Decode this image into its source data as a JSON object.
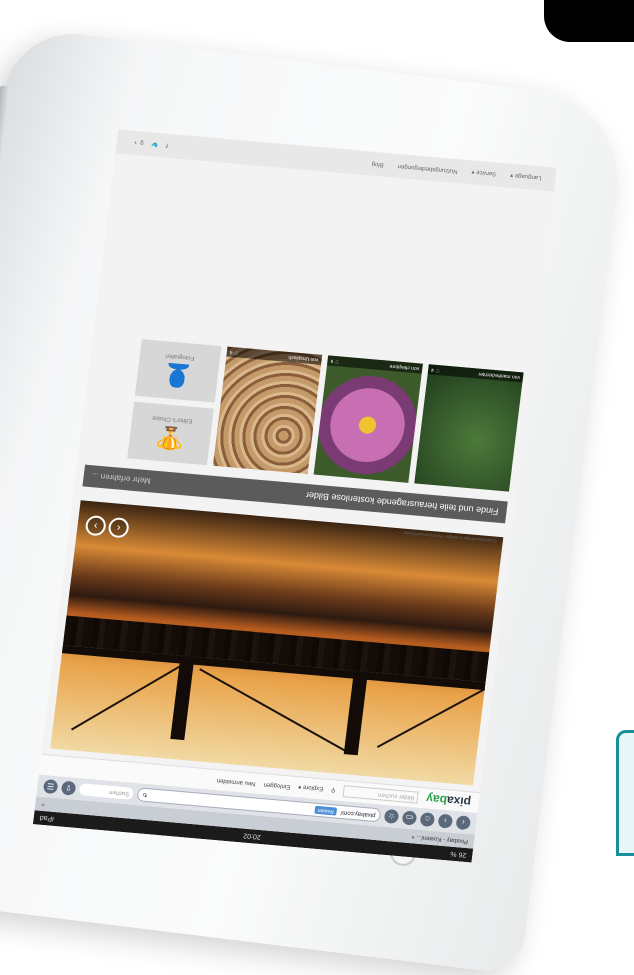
{
  "status_bar": {
    "time": "20:02",
    "left": "26 %",
    "right": "iPad"
  },
  "browser": {
    "tab_title": "Pixabay - Kostenl... ×",
    "new_tab": "+",
    "url": "pixabay.com/",
    "reader_label": "Reader",
    "search_placeholder": "Suchen"
  },
  "site_nav": {
    "logo_main": "pixa",
    "logo_accent": "bay",
    "search_placeholder": "Bilder suchen",
    "links": [
      "Explore ▾",
      "Einloggen",
      "Neu anmelden"
    ]
  },
  "hero": {
    "caption": "Suspension bridge at twilight - PublicDomainPictures",
    "prev": "‹",
    "next": "›"
  },
  "banner": {
    "headline": "Finde und teile herausragende kostenlose Bilder",
    "more": "Mehr erfahren ..."
  },
  "thumbnails": [
    {
      "label": "von manfredrichter",
      "likes": "♡ 4"
    },
    {
      "label": "von cfexplore",
      "likes": "♡ 6"
    },
    {
      "label": "von Unsplash",
      "likes": "♡ 4"
    }
  ],
  "tiles": [
    {
      "label": "Editor's Choice",
      "icon": "trophy-icon",
      "glyph": "🏆"
    },
    {
      "label": "Fotografen",
      "icon": "user-icon",
      "glyph": "👤"
    }
  ],
  "footer": {
    "links": [
      "Language ▾",
      "Service ▾",
      "Nutzungsbedingungen",
      "Blog"
    ],
    "social": "f 🐦 g+"
  },
  "colors": {
    "banner": "#5b5b5b",
    "logo_accent": "#2ba44e",
    "badge": "#4a8fd8"
  }
}
